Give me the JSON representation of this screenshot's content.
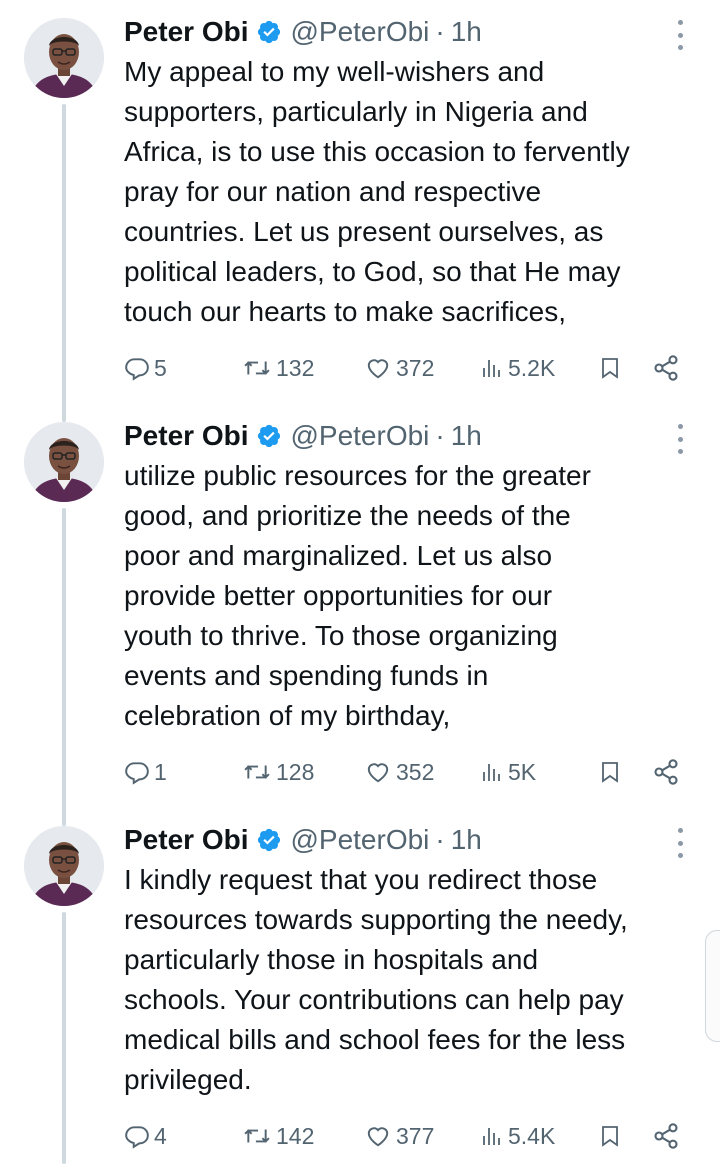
{
  "tweets": [
    {
      "author": {
        "name": "Peter Obi",
        "handle": "@PeterObi",
        "time": "1h",
        "avatar_icon": "profile-photo"
      },
      "text": "My appeal to my well-wishers and\nsupporters, particularly in Nigeria and\nAfrica, is to use this occasion to fervently\npray for our nation and respective\ncountries. Let us present ourselves, as\npolitical leaders, to God, so that He may\ntouch our hearts to make sacrifices,",
      "stats": {
        "replies": "5",
        "reposts": "132",
        "likes": "372",
        "views": "5.2K"
      }
    },
    {
      "author": {
        "name": "Peter Obi",
        "handle": "@PeterObi",
        "time": "1h",
        "avatar_icon": "profile-photo"
      },
      "text": "utilize public resources for the greater\ngood, and prioritize the needs of the\npoor and marginalized. Let us also\nprovide better opportunities for our\nyouth to thrive. To those organizing\nevents and spending funds in\ncelebration of my birthday,",
      "stats": {
        "replies": "1",
        "reposts": "128",
        "likes": "352",
        "views": "5K"
      }
    },
    {
      "author": {
        "name": "Peter Obi",
        "handle": "@PeterObi",
        "time": "1h",
        "avatar_icon": "profile-photo"
      },
      "text": "I kindly request that you redirect those\nresources towards supporting the needy,\nparticularly those in hospitals and\nschools. Your contributions can help pay\nmedical bills and school fees for the less\nprivileged.",
      "stats": {
        "replies": "4",
        "reposts": "142",
        "likes": "377",
        "views": "5.4K"
      }
    }
  ],
  "separator": "·",
  "colors": {
    "text": "#0f1419",
    "muted": "#536471",
    "verified": "#1d9bf0",
    "thread_line": "#cfd9de"
  },
  "icons": {
    "reply": "reply-icon",
    "repost": "repost-icon",
    "like": "heart-icon",
    "views": "views-icon",
    "bookmark": "bookmark-icon",
    "share": "share-icon",
    "more": "more-icon",
    "verified": "verified-badge-icon"
  }
}
